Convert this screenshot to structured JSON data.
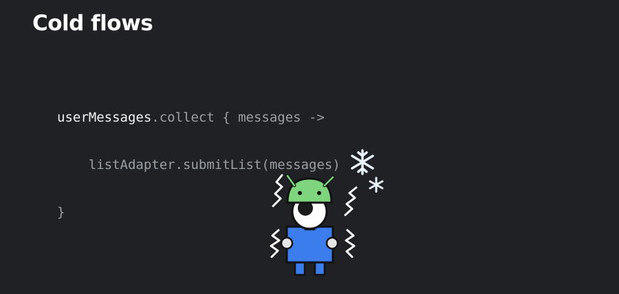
{
  "slide": {
    "title": "Cold flows"
  },
  "code": {
    "line1": {
      "highlight": "userMessages",
      "rest": ".collect { messages ->"
    },
    "line2": "    listAdapter.submitList(messages)",
    "line3": "}"
  },
  "illustration": {
    "icon": "shivering-android-mascot-icon",
    "snowflake_icon": "snowflake-icon",
    "colors": {
      "head": "#7ed57e",
      "eye_white": "#ffffff",
      "pupil": "#1a1a1a",
      "body": "#3b7ded",
      "legs": "#3b7ded",
      "hands": "#e6e6e6",
      "outline": "#111111",
      "snowflake": "#e8f0fe"
    }
  }
}
